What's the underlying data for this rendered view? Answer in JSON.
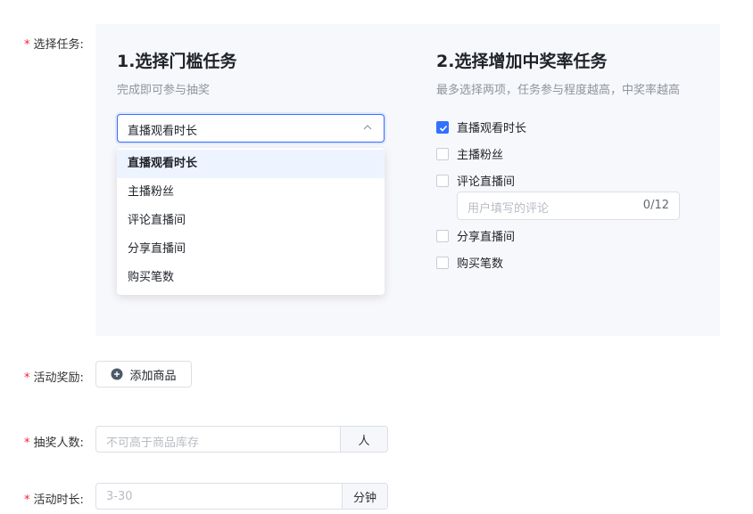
{
  "form": {
    "select_task_label": "选择任务:",
    "reward_label": "活动奖励:",
    "winners_label": "抽奖人数:",
    "duration_label": "活动时长:",
    "required_mark": "*"
  },
  "threshold": {
    "title": "1.选择门槛任务",
    "subtitle": "完成即可参与抽奖",
    "selected_value": "直播观看时长",
    "options": [
      "直播观看时长",
      "主播粉丝",
      "评论直播间",
      "分享直播间",
      "购买笔数"
    ]
  },
  "boost": {
    "title": "2.选择增加中奖率任务",
    "subtitle": "最多选择两项，任务参与程度越高，中奖率越高",
    "items": [
      {
        "label": "直播观看时长",
        "checked": true
      },
      {
        "label": "主播粉丝",
        "checked": false
      },
      {
        "label": "评论直播间",
        "checked": false
      },
      {
        "label": "分享直播间",
        "checked": false
      },
      {
        "label": "购买笔数",
        "checked": false
      }
    ],
    "comment_placeholder": "用户填写的评论",
    "comment_count": "0/12"
  },
  "reward": {
    "add_button": "添加商品"
  },
  "winners": {
    "placeholder": "不可高于商品库存",
    "suffix": "人"
  },
  "duration": {
    "placeholder": "3-30",
    "suffix": "分钟"
  },
  "colors": {
    "primary": "#3370ff",
    "required": "#f5222d",
    "panel_bg": "#f7f8fb"
  }
}
